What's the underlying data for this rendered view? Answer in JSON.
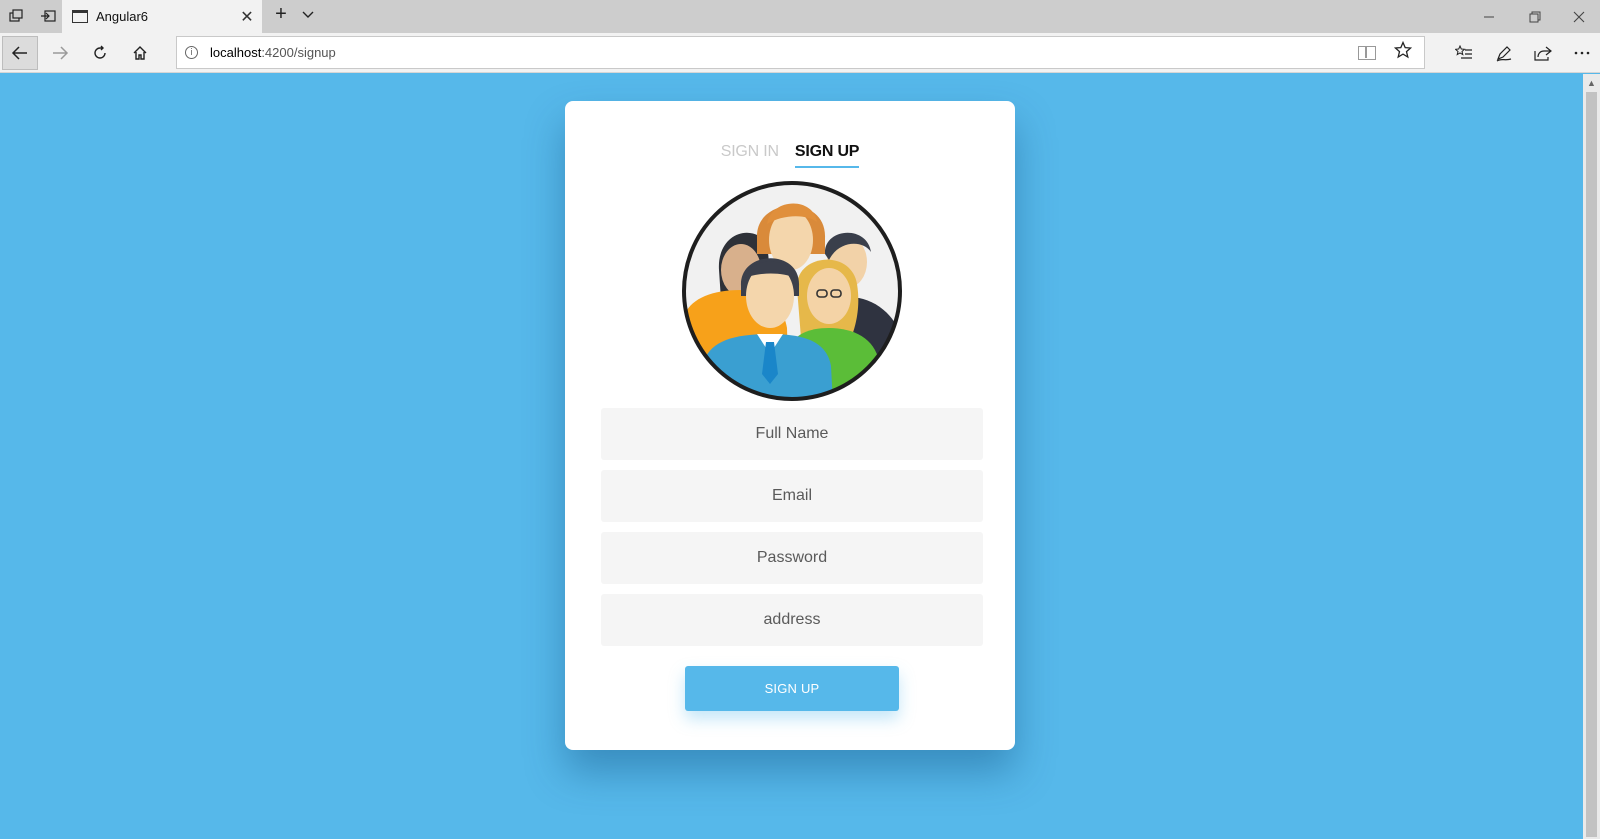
{
  "browser": {
    "tab_title": "Angular6",
    "url_host": "localhost",
    "url_rest": ":4200/signup",
    "controls": {
      "minimize": "—",
      "restore": "❐",
      "close": "✕",
      "new_tab": "+",
      "tab_close": "✕"
    },
    "icons": [
      "tab-actions-icon",
      "set-aside-tabs-icon",
      "page-icon",
      "back-arrow-icon",
      "forward-arrow-icon",
      "refresh-icon",
      "home-icon",
      "info-icon",
      "reading-view-icon",
      "favorite-star-icon",
      "favorites-list-icon",
      "pen-icon",
      "share-icon",
      "more-icon"
    ]
  },
  "auth": {
    "tabs": {
      "signin": "SIGN IN",
      "signup": "SIGN UP"
    },
    "fields": {
      "fullname_placeholder": "Full Name",
      "email_placeholder": "Email",
      "password_placeholder": "Password",
      "address_placeholder": "address"
    },
    "submit_label": "SIGN UP"
  },
  "colors": {
    "page_background": "#56b8ea",
    "accent": "#56b8ea",
    "card": "#ffffff",
    "field_background": "#f5f5f5"
  }
}
